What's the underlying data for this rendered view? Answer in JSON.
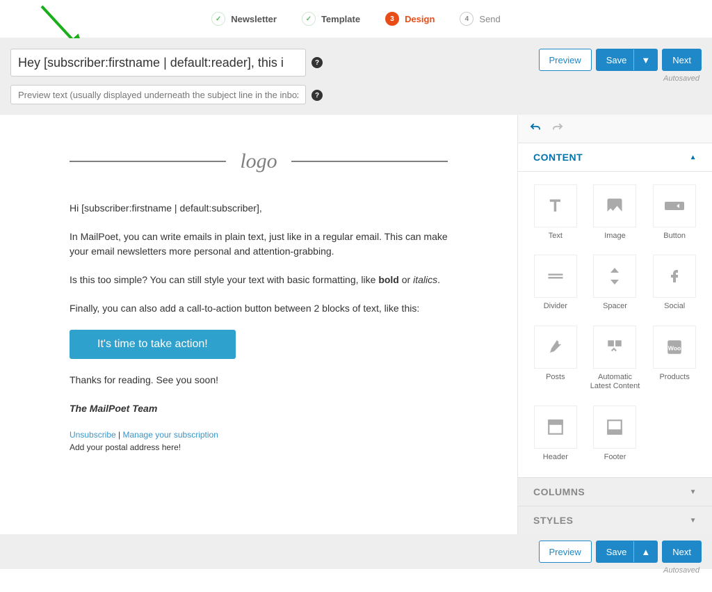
{
  "steps": [
    {
      "label": "Newsletter",
      "state": "done",
      "mark": "✓"
    },
    {
      "label": "Template",
      "state": "done",
      "mark": "✓"
    },
    {
      "label": "Design",
      "state": "active",
      "mark": "3"
    },
    {
      "label": "Send",
      "state": "pending",
      "mark": "4"
    }
  ],
  "subject_value": "Hey [subscriber:firstname | default:reader], this i",
  "preview_placeholder": "Preview text (usually displayed underneath the subject line in the inbox)",
  "buttons": {
    "preview": "Preview",
    "save": "Save",
    "next": "Next"
  },
  "autosaved_label": "Autosaved",
  "email": {
    "logo_text": "logo",
    "greeting": "Hi [subscriber:firstname | default:subscriber],",
    "p1a": "In MailPoet, you can write emails in plain text, just like in a regular email. This can make your email newsletters more personal and attention-grabbing.",
    "p2a": "Is this too simple? You can still style your text with basic formatting, like ",
    "p2_bold": "bold",
    "p2b": " or ",
    "p2_italic": "italics",
    "p2c": ".",
    "p3": "Finally, you can also add a call-to-action button between 2 blocks of text, like this:",
    "cta": "It's time to take action!",
    "thanks": "Thanks for reading. See you soon!",
    "signature": "The MailPoet Team",
    "unsubscribe": "Unsubscribe",
    "divider": " | ",
    "manage": "Manage your subscription",
    "postal": "Add your postal address here!"
  },
  "sidebar": {
    "panels": {
      "content": "CONTENT",
      "columns": "COLUMNS",
      "styles": "STYLES"
    },
    "widgets": [
      {
        "label": "Text",
        "icon": "text"
      },
      {
        "label": "Image",
        "icon": "image"
      },
      {
        "label": "Button",
        "icon": "button"
      },
      {
        "label": "Divider",
        "icon": "divider"
      },
      {
        "label": "Spacer",
        "icon": "spacer"
      },
      {
        "label": "Social",
        "icon": "social"
      },
      {
        "label": "Posts",
        "icon": "posts"
      },
      {
        "label": "Automatic Latest Content",
        "icon": "alc"
      },
      {
        "label": "Products",
        "icon": "products"
      },
      {
        "label": "Header",
        "icon": "header"
      },
      {
        "label": "Footer",
        "icon": "footer"
      }
    ]
  },
  "colors": {
    "accent": "#e94d17",
    "primary": "#1e88c9",
    "cta": "#2ea1cd"
  }
}
